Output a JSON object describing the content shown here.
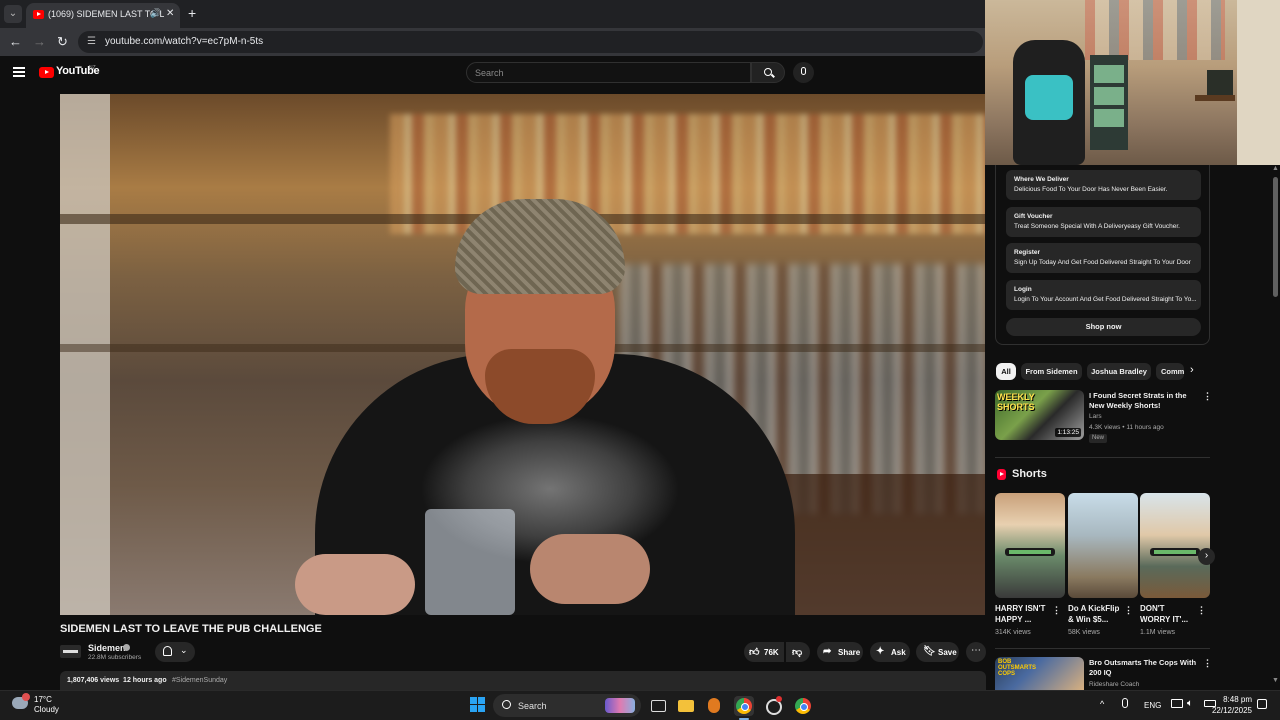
{
  "browser": {
    "tab_title": "(1069) SIDEMEN LAST TO LEAVE THE PUB CHALLENGE",
    "url": "youtube.com/watch?v=ec7pM-n-5ts",
    "icons": {
      "tab_list": "chevron-down-icon",
      "audio": "speaker-icon",
      "close": "close-icon",
      "new_tab": "plus-icon",
      "back": "arrow-left-icon",
      "forward": "arrow-right-icon",
      "reload": "reload-icon",
      "site_info": "tune-icon"
    }
  },
  "youtube_header": {
    "logo_text": "YouTube",
    "region": "NZ",
    "search_placeholder": "Search"
  },
  "video": {
    "title": "SIDEMEN LAST TO LEAVE THE PUB CHALLENGE",
    "channel_name": "Sidemen",
    "subscribers": "22.8M subscribers",
    "likes": "76K",
    "share_label": "Share",
    "ask_label": "Ask",
    "save_label": "Save",
    "views": "1,807,406 views",
    "age": "12 hours ago",
    "hashtag": "#SidemenSunday"
  },
  "sidebar": {
    "ad_items": [
      {
        "title": "Where We Deliver",
        "desc": "Delicious Food To Your Door Has Never Been Easier."
      },
      {
        "title": "Gift Voucher",
        "desc": "Treat Someone Special With A Deliveryeasy Gift Voucher."
      },
      {
        "title": "Register",
        "desc": "Sign Up Today And Get Food Delivered Straight To Your Door"
      },
      {
        "title": "Login",
        "desc": "Login To Your Account And Get Food Delivered Straight To Yo..."
      }
    ],
    "shop_now": "Shop now",
    "chips": [
      "All",
      "From Sidemen",
      "Joshua Bradley",
      "Comm"
    ],
    "recommended": {
      "thumb_text": "WEEKLY SHORTS",
      "duration": "1:13:25",
      "title": "I Found Secret Strats in the New Weekly Shorts!",
      "channel": "Lars",
      "meta": "4.3K views • 11 hours ago",
      "badge": "New"
    },
    "shorts_heading": "Shorts",
    "shorts": [
      {
        "title": "HARRY ISN'T HAPPY ...",
        "views": "314K views"
      },
      {
        "title": "Do A KickFlip & Win $5...",
        "views": "58K views"
      },
      {
        "title": "DON'T WORRY IT'...",
        "views": "1.1M views"
      }
    ],
    "recommended2": {
      "thumb_text": "BOB OUTSMARTS COPS",
      "title": "Bro Outsmarts The Cops With 200 IQ",
      "channel": "Rideshare Coach"
    }
  },
  "taskbar": {
    "weather_temp": "17°C",
    "weather_condition": "Cloudy",
    "search_label": "Search",
    "language": "ENG",
    "time": "8:48 pm",
    "date": "22/12/2025"
  }
}
